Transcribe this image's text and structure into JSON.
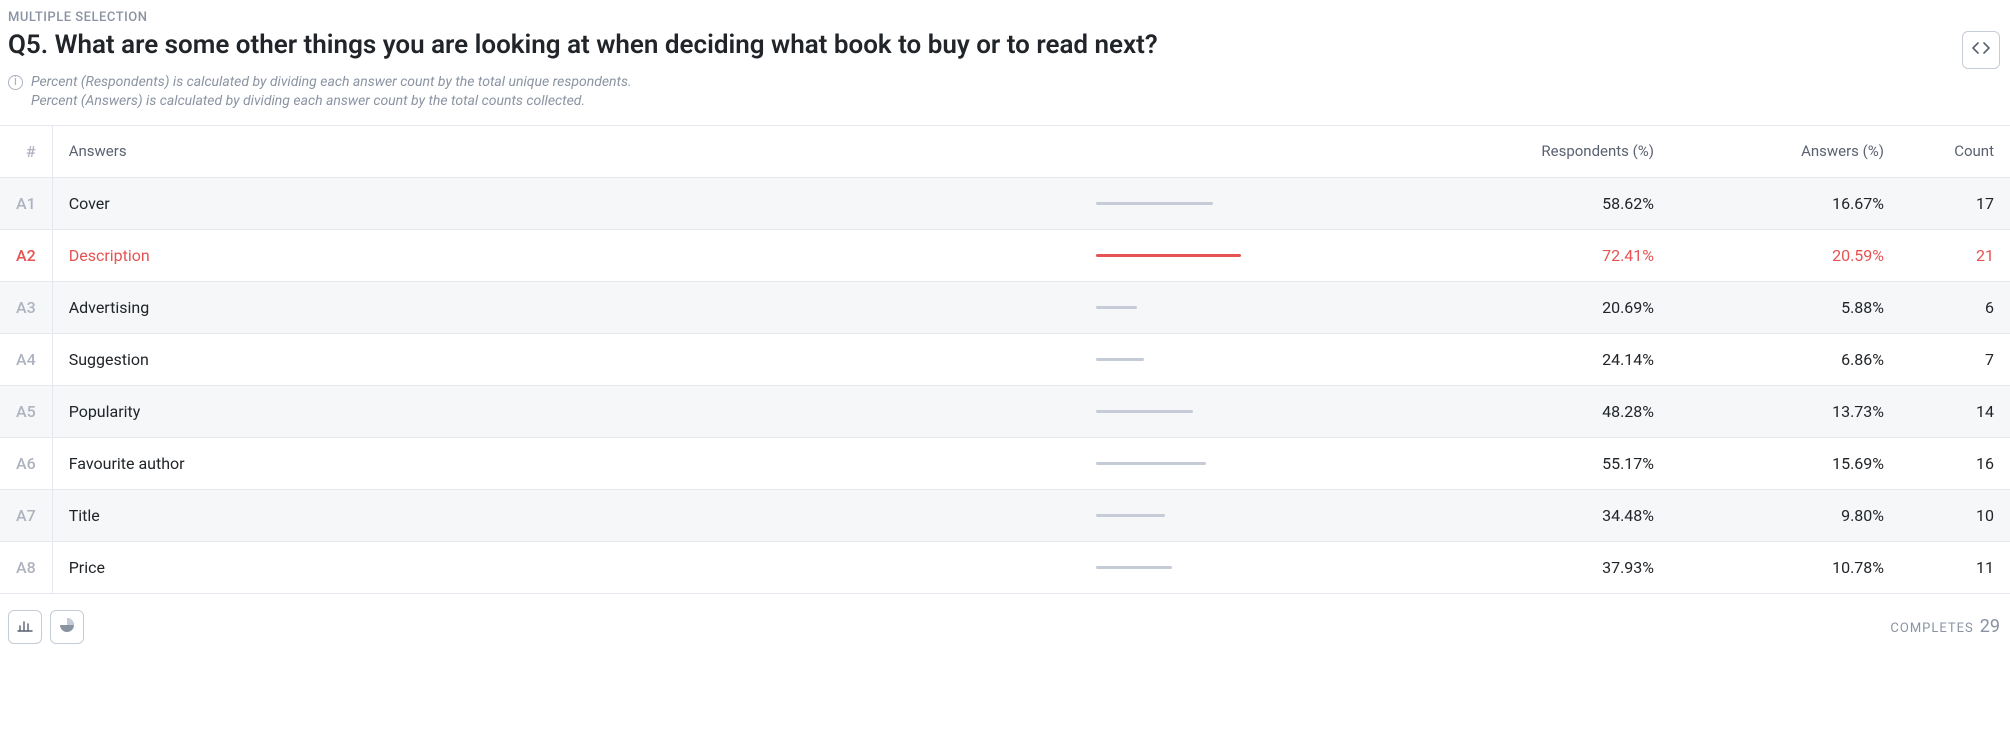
{
  "question_type": "MULTIPLE SELECTION",
  "question_title": "Q5. What are some other things you are looking at when deciding what book to buy or to read next?",
  "note_line1": "Percent (Respondents) is calculated by dividing each answer count by the total unique respondents.",
  "note_line2": "Percent (Answers) is calculated by dividing each answer count by the total counts collected.",
  "columns": {
    "idx": "#",
    "answers": "Answers",
    "respondents": "Respondents (%)",
    "answers_pct": "Answers (%)",
    "count": "Count"
  },
  "footer": {
    "completes_label": "COMPLETES",
    "completes_value": "29"
  },
  "chart_data": {
    "type": "table",
    "highlight_index": 1,
    "rows": [
      {
        "id": "A1",
        "label": "Cover",
        "respondents_pct": "58.62%",
        "answers_pct": "16.67%",
        "count": "17",
        "bar_pct": 58.62
      },
      {
        "id": "A2",
        "label": "Description",
        "respondents_pct": "72.41%",
        "answers_pct": "20.59%",
        "count": "21",
        "bar_pct": 72.41
      },
      {
        "id": "A3",
        "label": "Advertising",
        "respondents_pct": "20.69%",
        "answers_pct": "5.88%",
        "count": "6",
        "bar_pct": 20.69
      },
      {
        "id": "A4",
        "label": "Suggestion",
        "respondents_pct": "24.14%",
        "answers_pct": "6.86%",
        "count": "7",
        "bar_pct": 24.14
      },
      {
        "id": "A5",
        "label": "Popularity",
        "respondents_pct": "48.28%",
        "answers_pct": "13.73%",
        "count": "14",
        "bar_pct": 48.28
      },
      {
        "id": "A6",
        "label": "Favourite author",
        "respondents_pct": "55.17%",
        "answers_pct": "15.69%",
        "count": "16",
        "bar_pct": 55.17
      },
      {
        "id": "A7",
        "label": "Title",
        "respondents_pct": "34.48%",
        "answers_pct": "9.80%",
        "count": "10",
        "bar_pct": 34.48
      },
      {
        "id": "A8",
        "label": "Price",
        "respondents_pct": "37.93%",
        "answers_pct": "10.78%",
        "count": "11",
        "bar_pct": 37.93
      }
    ]
  }
}
